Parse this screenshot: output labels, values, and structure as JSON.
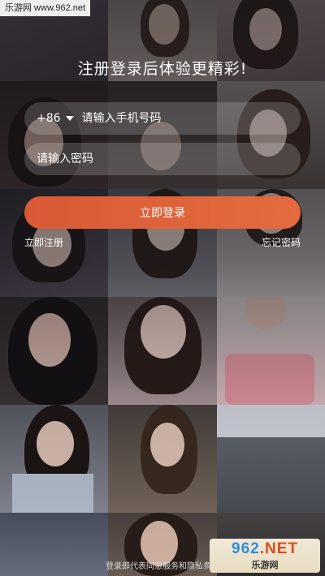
{
  "watermark_top": "乐游网 www.962.net",
  "headline": "注册登录后体验更精彩!",
  "phone_field": {
    "country_code": "+86",
    "placeholder": "请输入手机号码"
  },
  "password_field": {
    "placeholder": "请输入密码"
  },
  "login_button": "立即登录",
  "register_link": "立即注册",
  "forgot_link": "忘记密码",
  "terms_text": "登录即代表同意服务和隐私条款",
  "watermark_bottom": {
    "logo_a": "962",
    "logo_b": ".NET",
    "sub": "乐游网"
  },
  "colors": {
    "accent": "#e0633b"
  }
}
